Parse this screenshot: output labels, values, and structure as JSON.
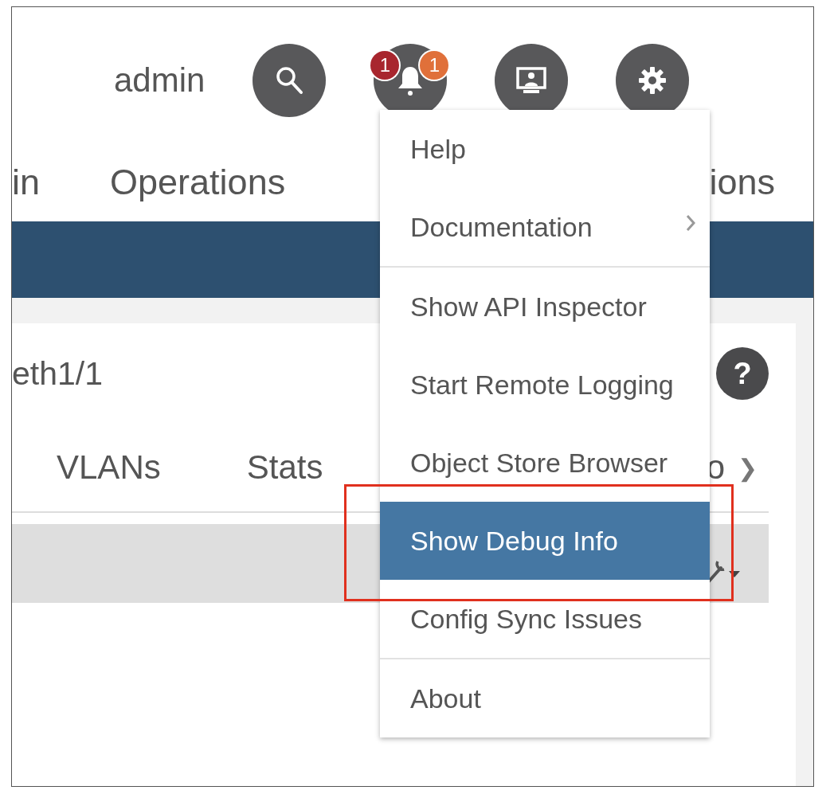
{
  "header": {
    "user": "admin",
    "icons": [
      {
        "kind": "search"
      },
      {
        "kind": "notifications",
        "badges": [
          {
            "text": "1",
            "color": "#a8262e"
          },
          {
            "text": "1",
            "color": "#e0703a"
          }
        ]
      },
      {
        "kind": "display"
      },
      {
        "kind": "settings"
      }
    ]
  },
  "nav": {
    "items": [
      "in",
      "Operations",
      "ions"
    ]
  },
  "panel": {
    "title": "eth1/1",
    "help": "?",
    "tabs": [
      "VLANs",
      "Stats",
      "o"
    ],
    "tabs_more": "❯"
  },
  "menu": {
    "sections": [
      [
        {
          "label": "Help",
          "submenu": false,
          "selected": false
        },
        {
          "label": "Documentation",
          "submenu": true,
          "selected": false
        }
      ],
      [
        {
          "label": "Show API Inspector",
          "submenu": false,
          "selected": false
        },
        {
          "label": "Start Remote Logging",
          "submenu": false,
          "selected": false
        },
        {
          "label": "Object Store Browser",
          "submenu": false,
          "selected": false
        },
        {
          "label": "Show Debug Info",
          "submenu": false,
          "selected": true
        },
        {
          "label": "Config Sync Issues",
          "submenu": false,
          "selected": false
        }
      ],
      [
        {
          "label": "About",
          "submenu": false,
          "selected": false
        }
      ]
    ]
  }
}
